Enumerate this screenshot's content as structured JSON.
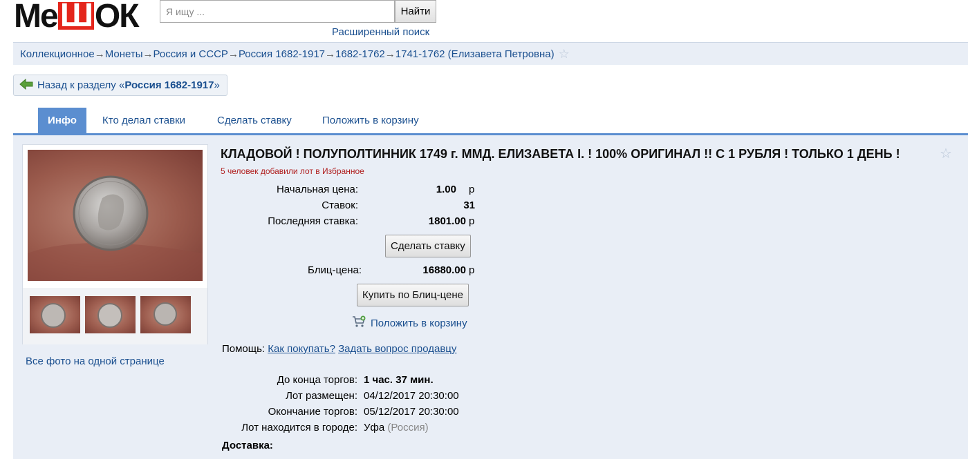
{
  "header": {
    "logo_left": "Ме",
    "logo_mid": "Ш",
    "logo_right": "ОК",
    "search_placeholder": "Я ищу ...",
    "search_button": "Найти",
    "advanced_search": "Расширенный поиск"
  },
  "breadcrumb": {
    "items": [
      "Коллекционное",
      "Монеты",
      "Россия и СССР",
      "Россия 1682-1917",
      "1682-1762",
      "1741-1762 (Елизавета Петровна)"
    ],
    "separator": "→"
  },
  "back": {
    "prefix": "Назад к разделу «",
    "section": "Россия 1682-1917",
    "suffix": "»"
  },
  "tabs": [
    "Инфо",
    "Кто делал ставки",
    "Сделать ставку",
    "Положить в корзину"
  ],
  "lot": {
    "title": "КЛАДОВОЙ ! ПОЛУПОЛТИННИК 1749 г. ММД. ЕЛИЗАВЕТА I. ! 100% ОРИГИНАЛ !! С 1 РУБЛЯ ! ТОЛЬКО 1 ДЕНЬ !",
    "favorites": "5 человек добавили лот в Избранное",
    "start_price_label": "Начальная цена:",
    "start_price": "1.00",
    "bids_label": "Ставок:",
    "bids": "31",
    "last_bid_label": "Последняя ставка:",
    "last_bid": "1801.00",
    "currency": "р",
    "bid_button": "Сделать ставку",
    "blitz_label": "Блиц-цена:",
    "blitz_price": "16880.00",
    "blitz_button": "Купить по Блиц-цене",
    "cart_link": "Положить в корзину",
    "help_label": "Помощь:",
    "help_how": "Как покупать?",
    "help_ask": "Задать вопрос продавцу",
    "all_photos": "Все фото на одной странице",
    "time_left_label": "До конца торгов:",
    "time_left": "1 час. 37 мин.",
    "posted_label": "Лот размещен:",
    "posted": "04/12/2017 20:30:00",
    "end_label": "Окончание торгов:",
    "end": "05/12/2017 20:30:00",
    "city_label": "Лот находится в городе:",
    "city": "Уфа",
    "country": "(Россия)",
    "delivery_label": "Доставка:"
  },
  "colors": {
    "accent": "#5b8ed0",
    "link": "#1a4f8f",
    "panel": "#e9eef6",
    "logo_red": "#e4261c"
  }
}
